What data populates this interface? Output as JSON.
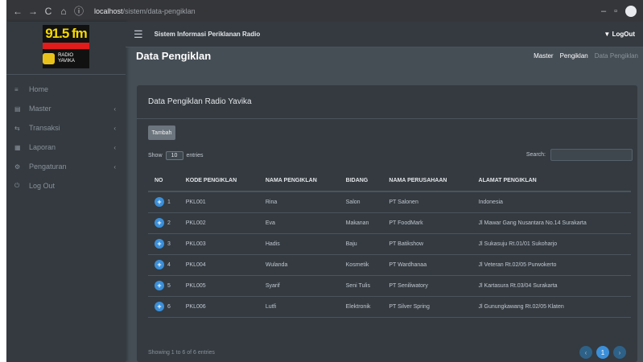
{
  "browser": {
    "url_host": "localhost",
    "url_path": "/sistem/data-pengiklan",
    "back_icon": "←",
    "forward_icon": "→",
    "reload_icon": "C",
    "home_icon": "⌂",
    "info_icon": "ⓘ"
  },
  "brand": {
    "frequency": "91.5 fm",
    "sub_text": "RADIO YAVIKA"
  },
  "sidebar": {
    "items": [
      {
        "label": "Home",
        "icon": "≡",
        "chevron": ""
      },
      {
        "label": "Master",
        "icon": "▤",
        "chevron": "‹"
      },
      {
        "label": "Transaksi",
        "icon": "⇆",
        "chevron": "‹"
      },
      {
        "label": "Laporan",
        "icon": "▦",
        "chevron": "‹"
      },
      {
        "label": "Pengaturan",
        "icon": "⚙",
        "chevron": "‹"
      },
      {
        "label": "Log Out",
        "icon": "⏻",
        "chevron": ""
      }
    ]
  },
  "topbar": {
    "menu_icon": "☰",
    "system_title": "Sistem Informasi Periklanan Radio",
    "logout_label": "▼ LogOut"
  },
  "page": {
    "title": "Data Pengiklan",
    "breadcrumb": [
      "Master",
      "Pengiklan",
      "Data Pengiklan"
    ]
  },
  "card": {
    "title": "Data Pengiklan Radio Yavika",
    "add_button": "Tambah",
    "show_label": "Show",
    "entries_count": "10",
    "entries_label": "entries",
    "search_label": "Search:",
    "search_placeholder": ""
  },
  "table": {
    "columns": [
      "NO",
      "KODE PENGIKLAN",
      "NAMA PENGIKLAN",
      "BIDANG",
      "NAMA PERUSAHAAN",
      "ALAMAT PENGIKLAN"
    ],
    "rows": [
      {
        "no": "1",
        "kode": "PKL001",
        "nama": "Rina",
        "bidang": "Salon",
        "perusahaan": "PT Salonen",
        "alamat": "Indonesia"
      },
      {
        "no": "2",
        "kode": "PKL002",
        "nama": "Eva",
        "bidang": "Makanan",
        "perusahaan": "PT FoodMark",
        "alamat": "Jl Mawar Gang Nusantara No.14 Surakarta"
      },
      {
        "no": "3",
        "kode": "PKL003",
        "nama": "Hadis",
        "bidang": "Baju",
        "perusahaan": "PT Batikshow",
        "alamat": "Jl Sukasuju Rt.01/01 Sukoharjo"
      },
      {
        "no": "4",
        "kode": "PKL004",
        "nama": "Wulanda",
        "bidang": "Kosmetik",
        "perusahaan": "PT Wardhanaa",
        "alamat": "Jl Veteran Rt.02/05 Purwokerto"
      },
      {
        "no": "5",
        "kode": "PKL005",
        "nama": "Syarif",
        "bidang": "Seni Tulis",
        "perusahaan": "PT Seniliwatory",
        "alamat": "Jl Kartasura Rt.03/04 Surakarta"
      },
      {
        "no": "6",
        "kode": "PKL006",
        "nama": "Lutfi",
        "bidang": "Elektronik",
        "perusahaan": "PT Silver Spring",
        "alamat": "Jl Gunungkawang Rt.02/05 Klaten"
      }
    ]
  },
  "footer": {
    "info": "Showing 1 to 6 of 6 entries",
    "prev": "‹",
    "current_page": "1",
    "next": "›"
  },
  "colors": {
    "sidebar_bg": "#343a40",
    "content_bg": "#454d55",
    "accent": "#3b8fd9"
  }
}
